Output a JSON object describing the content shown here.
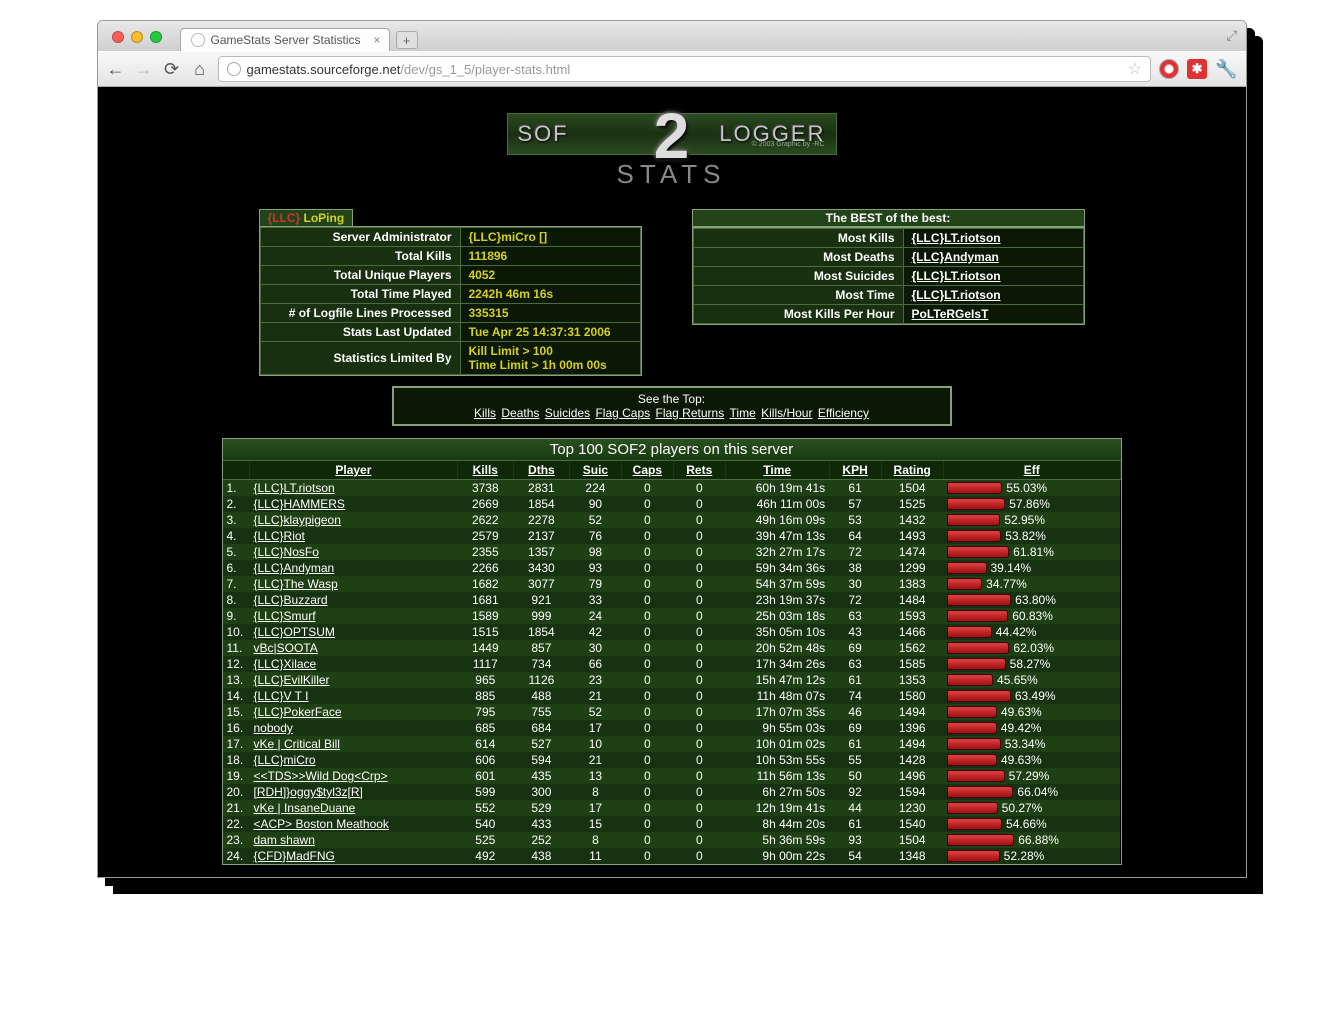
{
  "browser": {
    "tab_title": "GameStats Server Statistics",
    "url_host": "gamestats.sourceforge.net",
    "url_path": "/dev/gs_1_5/player-stats.html"
  },
  "logo": {
    "left": "SOF",
    "center": "2",
    "right": "LOGGER",
    "sub": "STATS",
    "copy": "© 2003 Graphic by -RC"
  },
  "server_box": {
    "title_tag": "{LLC}",
    "title_name": "LoPing",
    "rows": [
      {
        "label": "Server Administrator",
        "value": "{LLC}miCro []"
      },
      {
        "label": "Total Kills",
        "value": "111896"
      },
      {
        "label": "Total Unique Players",
        "value": "4052"
      },
      {
        "label": "Total Time Played",
        "value": "2242h 46m 16s"
      },
      {
        "label": "# of Logfile Lines Processed",
        "value": "335315"
      },
      {
        "label": "Stats Last Updated",
        "value": "Tue Apr 25 14:37:31 2006"
      },
      {
        "label": "Statistics Limited By",
        "value": "Kill Limit > 100\nTime Limit > 1h 00m 00s"
      }
    ]
  },
  "best_box": {
    "title": "The BEST of the best:",
    "rows": [
      {
        "label": "Most Kills",
        "value": "{LLC}LT.riotson"
      },
      {
        "label": "Most Deaths",
        "value": "{LLC}Andyman"
      },
      {
        "label": "Most Suicides",
        "value": "{LLC}LT.riotson"
      },
      {
        "label": "Most Time",
        "value": "{LLC}LT.riotson"
      },
      {
        "label": "Most Kills Per Hour",
        "value": "PoLTeRGeIsT"
      }
    ]
  },
  "seetop": {
    "prefix": "See the Top:",
    "links": [
      "Kills",
      "Deaths",
      "Suicides",
      "Flag Caps",
      "Flag Returns",
      "Time",
      "Kills/Hour",
      "Efficiency"
    ]
  },
  "bigtable": {
    "title": "Top 100 SOF2 players on this server",
    "headers": [
      "Player",
      "Kills",
      "Dths",
      "Suic",
      "Caps",
      "Rets",
      "Time",
      "KPH",
      "Rating",
      "Eff"
    ],
    "rows": [
      {
        "rank": "1.",
        "player": "{LLC}LT.riotson",
        "kills": "3738",
        "dths": "2831",
        "suic": "224",
        "caps": "0",
        "rets": "0",
        "time": "60h 19m 41s",
        "kph": "61",
        "rating": "1504",
        "eff": 55.03
      },
      {
        "rank": "2.",
        "player": "{LLC}HAMMERS",
        "kills": "2669",
        "dths": "1854",
        "suic": "90",
        "caps": "0",
        "rets": "0",
        "time": "46h 11m 00s",
        "kph": "57",
        "rating": "1525",
        "eff": 57.86
      },
      {
        "rank": "3.",
        "player": "{LLC}klaypigeon",
        "kills": "2622",
        "dths": "2278",
        "suic": "52",
        "caps": "0",
        "rets": "0",
        "time": "49h 16m 09s",
        "kph": "53",
        "rating": "1432",
        "eff": 52.95
      },
      {
        "rank": "4.",
        "player": "{LLC}Riot",
        "kills": "2579",
        "dths": "2137",
        "suic": "76",
        "caps": "0",
        "rets": "0",
        "time": "39h 47m 13s",
        "kph": "64",
        "rating": "1493",
        "eff": 53.82
      },
      {
        "rank": "5.",
        "player": "{LLC}NosFo",
        "kills": "2355",
        "dths": "1357",
        "suic": "98",
        "caps": "0",
        "rets": "0",
        "time": "32h 27m 17s",
        "kph": "72",
        "rating": "1474",
        "eff": 61.81
      },
      {
        "rank": "6.",
        "player": "{LLC}Andyman",
        "kills": "2266",
        "dths": "3430",
        "suic": "93",
        "caps": "0",
        "rets": "0",
        "time": "59h 34m 36s",
        "kph": "38",
        "rating": "1299",
        "eff": 39.14
      },
      {
        "rank": "7.",
        "player": "{LLC}The Wasp",
        "kills": "1682",
        "dths": "3077",
        "suic": "79",
        "caps": "0",
        "rets": "0",
        "time": "54h 37m 59s",
        "kph": "30",
        "rating": "1383",
        "eff": 34.77
      },
      {
        "rank": "8.",
        "player": "{LLC}Buzzard",
        "kills": "1681",
        "dths": "921",
        "suic": "33",
        "caps": "0",
        "rets": "0",
        "time": "23h 19m 37s",
        "kph": "72",
        "rating": "1484",
        "eff": 63.8
      },
      {
        "rank": "9.",
        "player": "{LLC}Smurf",
        "kills": "1589",
        "dths": "999",
        "suic": "24",
        "caps": "0",
        "rets": "0",
        "time": "25h 03m 18s",
        "kph": "63",
        "rating": "1593",
        "eff": 60.83
      },
      {
        "rank": "10.",
        "player": "{LLC}OPTSUM",
        "kills": "1515",
        "dths": "1854",
        "suic": "42",
        "caps": "0",
        "rets": "0",
        "time": "35h 05m 10s",
        "kph": "43",
        "rating": "1466",
        "eff": 44.42
      },
      {
        "rank": "11.",
        "player": "vBc|SOOTA",
        "kills": "1449",
        "dths": "857",
        "suic": "30",
        "caps": "0",
        "rets": "0",
        "time": "20h 52m 48s",
        "kph": "69",
        "rating": "1562",
        "eff": 62.03
      },
      {
        "rank": "12.",
        "player": "{LLC}Xilace",
        "kills": "1117",
        "dths": "734",
        "suic": "66",
        "caps": "0",
        "rets": "0",
        "time": "17h 34m 26s",
        "kph": "63",
        "rating": "1585",
        "eff": 58.27
      },
      {
        "rank": "13.",
        "player": "{LLC}EvilKiller",
        "kills": "965",
        "dths": "1126",
        "suic": "23",
        "caps": "0",
        "rets": "0",
        "time": "15h 47m 12s",
        "kph": "61",
        "rating": "1353",
        "eff": 45.65
      },
      {
        "rank": "14.",
        "player": "{LLC}V T I",
        "kills": "885",
        "dths": "488",
        "suic": "21",
        "caps": "0",
        "rets": "0",
        "time": "11h 48m 07s",
        "kph": "74",
        "rating": "1580",
        "eff": 63.49
      },
      {
        "rank": "15.",
        "player": "{LLC}PokerFace",
        "kills": "795",
        "dths": "755",
        "suic": "52",
        "caps": "0",
        "rets": "0",
        "time": "17h 07m 35s",
        "kph": "46",
        "rating": "1494",
        "eff": 49.63
      },
      {
        "rank": "16.",
        "player": "nobody",
        "kills": "685",
        "dths": "684",
        "suic": "17",
        "caps": "0",
        "rets": "0",
        "time": "9h 55m 03s",
        "kph": "69",
        "rating": "1396",
        "eff": 49.42
      },
      {
        "rank": "17.",
        "player": "vKe | Critical Bill",
        "kills": "614",
        "dths": "527",
        "suic": "10",
        "caps": "0",
        "rets": "0",
        "time": "10h 01m 02s",
        "kph": "61",
        "rating": "1494",
        "eff": 53.34
      },
      {
        "rank": "18.",
        "player": "{LLC}miCro",
        "kills": "606",
        "dths": "594",
        "suic": "21",
        "caps": "0",
        "rets": "0",
        "time": "10h 53m 55s",
        "kph": "55",
        "rating": "1428",
        "eff": 49.63
      },
      {
        "rank": "19.",
        "player": "<<TDS>>Wild Dog<Crp>",
        "kills": "601",
        "dths": "435",
        "suic": "13",
        "caps": "0",
        "rets": "0",
        "time": "11h 56m 13s",
        "kph": "50",
        "rating": "1496",
        "eff": 57.29
      },
      {
        "rank": "20.",
        "player": "[RDH]}oggy$tyl3z[R]",
        "kills": "599",
        "dths": "300",
        "suic": "8",
        "caps": "0",
        "rets": "0",
        "time": "6h 27m 50s",
        "kph": "92",
        "rating": "1594",
        "eff": 66.04
      },
      {
        "rank": "21.",
        "player": "vKe | InsaneDuane",
        "kills": "552",
        "dths": "529",
        "suic": "17",
        "caps": "0",
        "rets": "0",
        "time": "12h 19m 41s",
        "kph": "44",
        "rating": "1230",
        "eff": 50.27
      },
      {
        "rank": "22.",
        "player": "<ACP> Boston Meathook",
        "kills": "540",
        "dths": "433",
        "suic": "15",
        "caps": "0",
        "rets": "0",
        "time": "8h 44m 20s",
        "kph": "61",
        "rating": "1540",
        "eff": 54.66
      },
      {
        "rank": "23.",
        "player": "dam shawn",
        "kills": "525",
        "dths": "252",
        "suic": "8",
        "caps": "0",
        "rets": "0",
        "time": "5h 36m 59s",
        "kph": "93",
        "rating": "1504",
        "eff": 66.88
      },
      {
        "rank": "24.",
        "player": "{CFD}MadFNG",
        "kills": "492",
        "dths": "438",
        "suic": "11",
        "caps": "0",
        "rets": "0",
        "time": "9h 00m 22s",
        "kph": "54",
        "rating": "1348",
        "eff": 52.28
      }
    ]
  }
}
